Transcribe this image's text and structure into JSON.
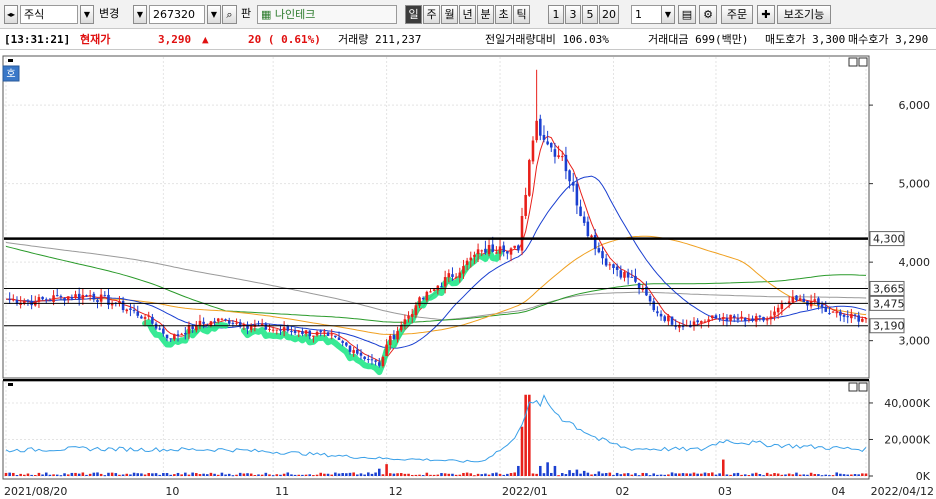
{
  "toolbar": {
    "market_label": "주식",
    "change_label": "변경",
    "code_value": "267320",
    "board_label": "판",
    "stock_name": "나인테크",
    "period_buttons": [
      "일",
      "주",
      "월",
      "년",
      "분",
      "초",
      "틱"
    ],
    "active_period": "일",
    "interval_buttons": [
      "1",
      "3",
      "5",
      "20"
    ],
    "interval_value": "1",
    "order_label": "주문",
    "indicator_label": "보조기능",
    "colors": {
      "active_bg": "#3c3c3c",
      "toolbar_bg": "#f2f2f2"
    }
  },
  "status": {
    "time": "[13:31:21]",
    "price_label": "현재가",
    "price": "3,290",
    "change_arrow": "▲",
    "change": "20 ( 0.61%)",
    "volume": "거래량 211,237",
    "prev_volume_ratio": "전일거래량대비 106.03%",
    "amount": "거래대금 699(백만)",
    "ask": "매도호가 3,300",
    "bid": "매수호가 3,290"
  },
  "price_panel_tag": "호",
  "chart_data": [
    {
      "type": "candlestick",
      "x_start": "2021/08/20",
      "x_end": "2022/04/12",
      "ylim": [
        2550,
        6600
      ],
      "y_ticks": [
        "3,000",
        "4,000",
        "5,000",
        "6,000"
      ],
      "y_tick_values": [
        3000,
        4000,
        5000,
        6000
      ],
      "x_tick_labels": [
        "2021/08/20",
        "10",
        "11",
        "12",
        "2022/01",
        "02",
        "03",
        "04",
        "2022/04/12"
      ],
      "x_tick_days": [
        0,
        43,
        73,
        104,
        135,
        166,
        194,
        225,
        235
      ],
      "horizontal_lines": [
        {
          "label": "4,300",
          "value": 4300,
          "weight": "heavy"
        },
        {
          "label": "3,665",
          "value": 3665,
          "weight": "thin"
        },
        {
          "label": "3,475",
          "value": 3475,
          "weight": "thin"
        },
        {
          "label": "3,190",
          "value": 3190,
          "weight": "thin"
        }
      ],
      "current_price": 3290,
      "colors": {
        "up": "#e8201a",
        "down": "#1a3fd0",
        "ma5": "#e8201a",
        "ma20": "#1a3fd0",
        "ma60": "#f0a020",
        "ma120": "#2a9a2a",
        "ma240": "#9a9a9a",
        "trend": "#22e88a"
      },
      "anchor_days": [
        0,
        8,
        15,
        23,
        30,
        38,
        45,
        52,
        60,
        65,
        72,
        80,
        88,
        95,
        102,
        104,
        108,
        112,
        118,
        125,
        130,
        135,
        140,
        143,
        145,
        148,
        152,
        158,
        163,
        167,
        172,
        178,
        184,
        190,
        196,
        202,
        208,
        214,
        220,
        225,
        230,
        235
      ],
      "anchor_closes": [
        3530,
        3500,
        3560,
        3580,
        3470,
        3300,
        3030,
        3200,
        3270,
        3210,
        3150,
        3120,
        3060,
        2880,
        2680,
        2950,
        3200,
        3450,
        3700,
        3950,
        4150,
        4200,
        4150,
        5300,
        5800,
        5500,
        5350,
        4500,
        4050,
        3900,
        3750,
        3350,
        3200,
        3250,
        3300,
        3250,
        3270,
        3500,
        3500,
        3350,
        3300,
        3290
      ],
      "volume_panel": {
        "type": "bar",
        "y_ticks": [
          "0K",
          "20,000K",
          "40,000K"
        ],
        "y_tick_values": [
          0,
          20000,
          40000
        ],
        "ylim": [
          0,
          46000
        ],
        "spike_days": [
          102,
          104,
          140,
          141,
          142,
          143,
          146,
          148,
          150,
          154,
          156,
          158,
          162,
          196
        ],
        "spike_values": [
          4000,
          6500,
          5500,
          27000,
          44500,
          44500,
          5500,
          7500,
          5500,
          3200,
          3500,
          2800,
          2500,
          9000
        ],
        "baseline": 1100,
        "avg_line_days": [
          0,
          20,
          40,
          60,
          80,
          95,
          104,
          115,
          125,
          130,
          138,
          143,
          147,
          152,
          157,
          162,
          170,
          190,
          196,
          210,
          225,
          235
        ],
        "avg_line_values": [
          14000,
          15000,
          14500,
          14500,
          12500,
          10500,
          9500,
          9000,
          8000,
          8000,
          18000,
          38000,
          41000,
          32000,
          26000,
          20000,
          15000,
          14500,
          19500,
          17000,
          15500,
          14500
        ]
      }
    }
  ]
}
